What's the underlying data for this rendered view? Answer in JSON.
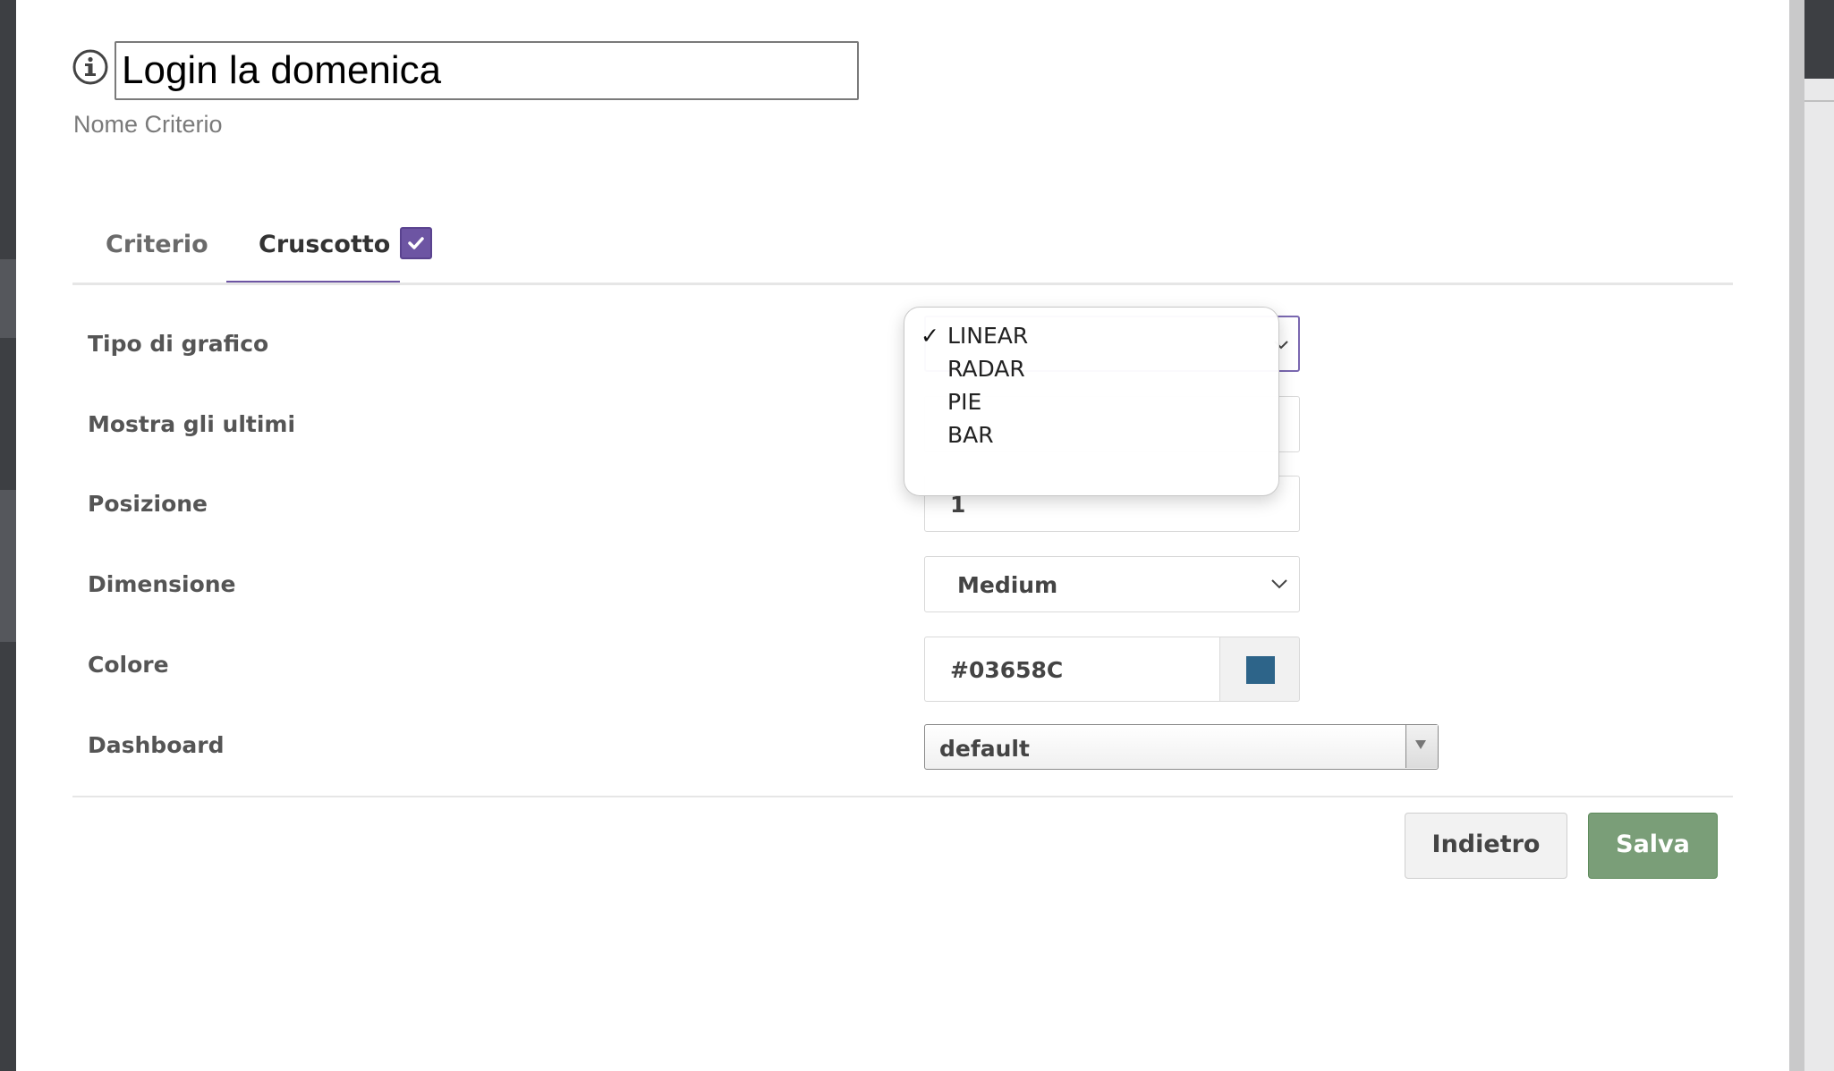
{
  "criterion": {
    "name_value": "Login la domenica",
    "name_hint": "Nome Criterio"
  },
  "tabs": [
    {
      "label": "Criterio",
      "active": false
    },
    {
      "label": "Cruscotto",
      "active": true,
      "checked": true
    }
  ],
  "form": {
    "tipo_label": "Tipo di grafico",
    "mostra_label": "Mostra gli ultimi",
    "posizione_label": "Posizione",
    "posizione_value": "1",
    "dimensione_label": "Dimensione",
    "dimensione_value": "Medium",
    "colore_label": "Colore",
    "colore_value": "#03658C",
    "dashboard_label": "Dashboard",
    "dashboard_value": "default"
  },
  "dropdown": {
    "options": [
      "LINEAR",
      "RADAR",
      "PIE",
      "BAR"
    ],
    "selected": "LINEAR"
  },
  "buttons": {
    "back_label": "Indietro",
    "save_label": "Salva"
  },
  "colors": {
    "accent": "#6d55a3",
    "save": "#7a9e78",
    "swatch": "#2d6489"
  }
}
